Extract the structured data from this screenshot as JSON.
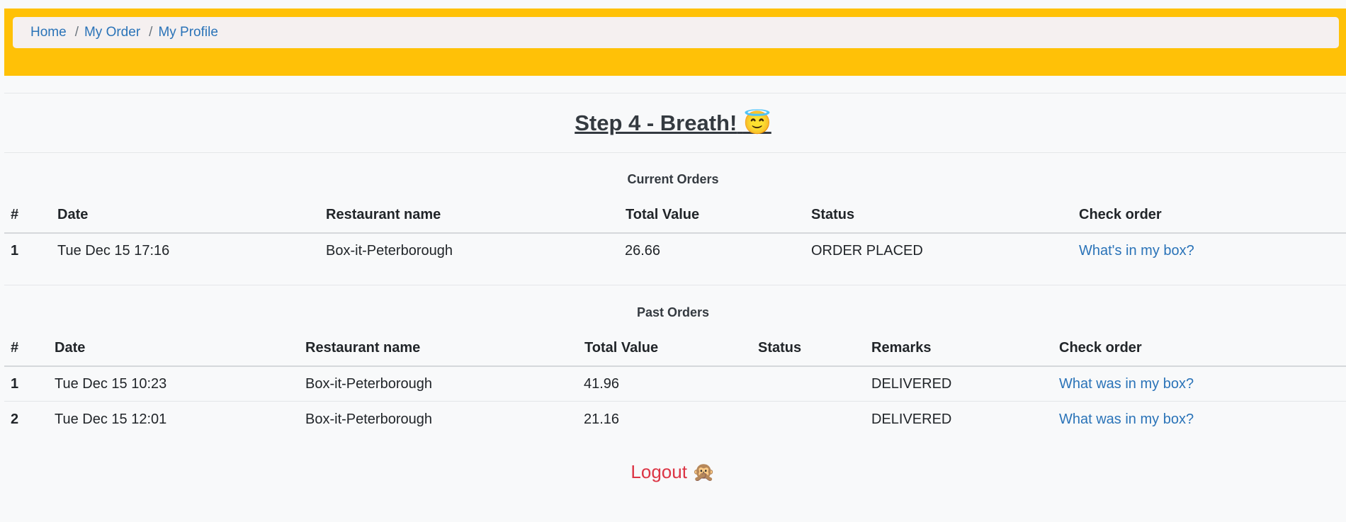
{
  "breadcrumb": {
    "items": [
      "Home",
      "My Order",
      "My Profile"
    ],
    "separator": "/"
  },
  "page": {
    "title": "Step 4 - Breath!",
    "title_emoji": "😇"
  },
  "current_orders": {
    "title": "Current Orders",
    "columns": [
      "#",
      "Date",
      "Restaurant name",
      "Total Value",
      "Status",
      "Check order"
    ],
    "rows": [
      {
        "num": "1",
        "date": "Tue Dec 15 17:16",
        "restaurant": "Box-it-Peterborough",
        "total": "26.66",
        "status": "ORDER PLACED",
        "link": "What's in my box?"
      }
    ]
  },
  "past_orders": {
    "title": "Past Orders",
    "columns": [
      "#",
      "Date",
      "Restaurant name",
      "Total Value",
      "Status",
      "Remarks",
      "Check order"
    ],
    "rows": [
      {
        "num": "1",
        "date": "Tue Dec 15 10:23",
        "restaurant": "Box-it-Peterborough",
        "total": "41.96",
        "status": "",
        "remarks": "DELIVERED",
        "link": "What was in my box?"
      },
      {
        "num": "2",
        "date": "Tue Dec 15 12:01",
        "restaurant": "Box-it-Peterborough",
        "total": "21.16",
        "status": "",
        "remarks": "DELIVERED",
        "link": "What was in my box?"
      }
    ]
  },
  "logout": {
    "label": "Logout",
    "emoji": "🙊"
  },
  "colors": {
    "header": "#ffc107",
    "link": "#2a73b8",
    "logout": "#dc3545"
  }
}
